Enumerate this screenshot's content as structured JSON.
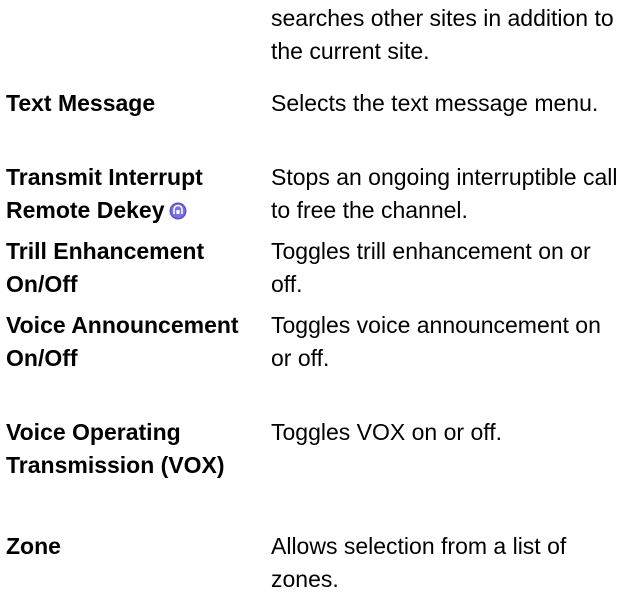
{
  "continuation_text": "searches other sites in addition to the current site.",
  "rows": [
    {
      "term": "Text Message",
      "description": "Selects the text message menu."
    },
    {
      "term": "Transmit Interrupt Remote Dekey",
      "description": "Stops an ongoing interruptible call to free the channel.",
      "icon": "feature-badge-icon"
    },
    {
      "term": "Trill Enhancement On/Off",
      "description": "Toggles trill enhancement on or off."
    },
    {
      "term": "Voice Announcement On/Off",
      "description": "Toggles voice announcement on or off."
    },
    {
      "term": "Voice Operating Transmission (VOX)",
      "description": "Toggles VOX on or off."
    },
    {
      "term": "Zone",
      "description": "Allows selection from a list of zones."
    }
  ],
  "colors": {
    "text": "#000000",
    "badge_fill": "#5a4fcf",
    "badge_highlight": "#b9b2ff",
    "background": "#ffffff"
  }
}
